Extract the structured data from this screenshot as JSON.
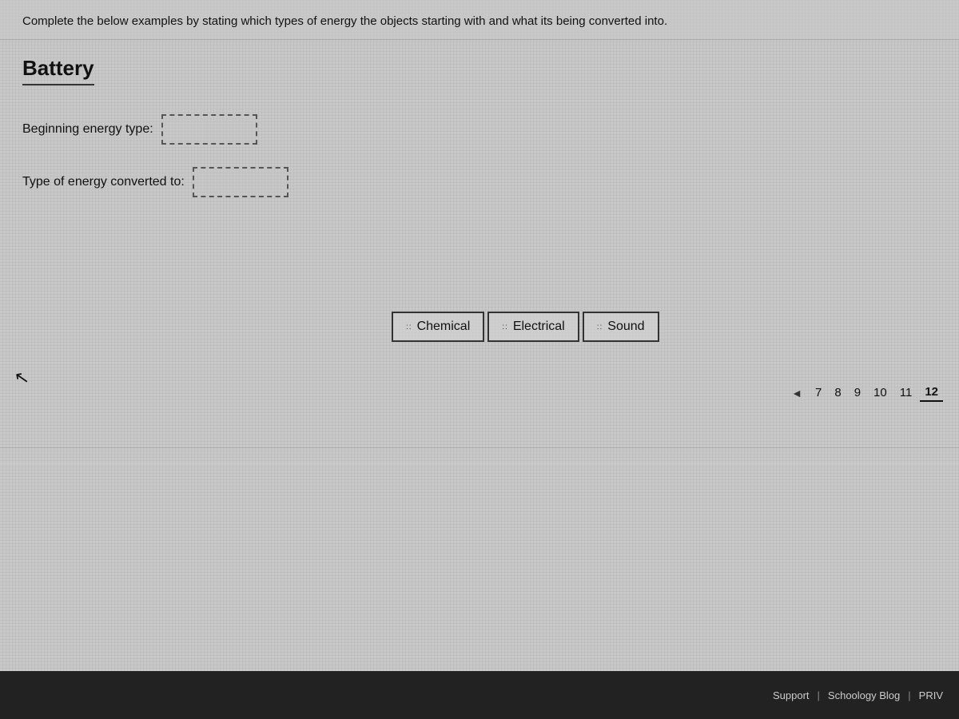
{
  "page": {
    "instruction": "Complete the below examples by stating which types of energy the objects starting with and what its being converted into.",
    "section": {
      "title": "Battery",
      "fields": [
        {
          "label": "Beginning energy type:",
          "name": "beginning-energy-field"
        },
        {
          "label": "Type of energy converted to:",
          "name": "converted-energy-field"
        }
      ]
    },
    "answer_chips": [
      {
        "label": "Chemical",
        "icon": "::"
      },
      {
        "label": "Electrical",
        "icon": "::"
      },
      {
        "label": "Sound",
        "icon": "::"
      }
    ],
    "pagination": {
      "arrow_left": "◄",
      "pages": [
        "7",
        "8",
        "9",
        "10",
        "11",
        "12"
      ],
      "active_page": "12"
    },
    "footer": {
      "links": [
        "Support",
        "Schoology Blog",
        "PRIV"
      ]
    }
  }
}
